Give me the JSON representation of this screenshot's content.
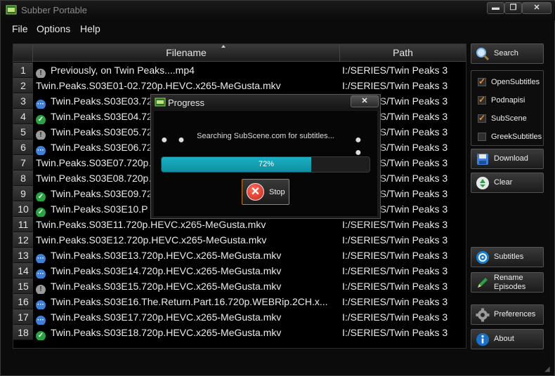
{
  "window": {
    "title": "Subber Portable",
    "min_label": "▬",
    "max_label": "❐",
    "close_label": "✕"
  },
  "menu": [
    "File",
    "Options",
    "Help"
  ],
  "table": {
    "columns": {
      "filename": "Filename",
      "path": "Path"
    },
    "rows": [
      {
        "num": "1",
        "status": "warn",
        "file": "Previously, on Twin Peaks....mp4",
        "path": "I:/SERIES/Twin Peaks 3"
      },
      {
        "num": "2",
        "status": "none",
        "file": "Twin.Peaks.S03E01-02.720p.HEVC.x265-MeGusta.mkv",
        "path": "I:/SERIES/Twin Peaks 3"
      },
      {
        "num": "3",
        "status": "wait",
        "file": "Twin.Peaks.S03E03.720p.HEVC.x265-MeGusta.mkv",
        "path": "I:/SERIES/Twin Peaks 3"
      },
      {
        "num": "4",
        "status": "ok",
        "file": "Twin.Peaks.S03E04.720p.HEVC.x265-MeGusta.mkv",
        "path": "I:/SERIES/Twin Peaks 3"
      },
      {
        "num": "5",
        "status": "warn",
        "file": "Twin.Peaks.S03E05.720p.HEVC.x265-MeGusta.mkv",
        "path": "I:/SERIES/Twin Peaks 3"
      },
      {
        "num": "6",
        "status": "wait",
        "file": "Twin.Peaks.S03E06.720p.HEVC.x265-MeGusta.mkv",
        "path": "I:/SERIES/Twin Peaks 3"
      },
      {
        "num": "7",
        "status": "none",
        "file": "Twin.Peaks.S03E07.720p.HEVC.x265-MeGusta.mkv",
        "path": "I:/SERIES/Twin Peaks 3"
      },
      {
        "num": "8",
        "status": "none",
        "file": "Twin.Peaks.S03E08.720p.HEVC.x265-MeGusta.mkv",
        "path": "I:/SERIES/Twin Peaks 3"
      },
      {
        "num": "9",
        "status": "ok",
        "file": "Twin.Peaks.S03E09.720p.HEVC.x265-MeGusta.mkv",
        "path": "I:/SERIES/Twin Peaks 3"
      },
      {
        "num": "10",
        "status": "ok",
        "file": "Twin.Peaks.S03E10.P",
        "path": "I:/SERIES/Twin Peaks 3"
      },
      {
        "num": "11",
        "status": "none",
        "file": "Twin.Peaks.S03E11.720p.HEVC.x265-MeGusta.mkv",
        "path": "I:/SERIES/Twin Peaks 3"
      },
      {
        "num": "12",
        "status": "none",
        "file": "Twin.Peaks.S03E12.720p.HEVC.x265-MeGusta.mkv",
        "path": "I:/SERIES/Twin Peaks 3"
      },
      {
        "num": "13",
        "status": "wait",
        "file": "Twin.Peaks.S03E13.720p.HEVC.x265-MeGusta.mkv",
        "path": "I:/SERIES/Twin Peaks 3"
      },
      {
        "num": "14",
        "status": "wait",
        "file": "Twin.Peaks.S03E14.720p.HEVC.x265-MeGusta.mkv",
        "path": "I:/SERIES/Twin Peaks 3"
      },
      {
        "num": "15",
        "status": "warn",
        "file": "Twin.Peaks.S03E15.720p.HEVC.x265-MeGusta.mkv",
        "path": "I:/SERIES/Twin Peaks 3"
      },
      {
        "num": "16",
        "status": "wait",
        "file": "Twin.Peaks.S03E16.The.Return.Part.16.720p.WEBRip.2CH.x...",
        "path": "I:/SERIES/Twin Peaks 3"
      },
      {
        "num": "17",
        "status": "wait",
        "file": "Twin.Peaks.S03E17.720p.HEVC.x265-MeGusta.mkv",
        "path": "I:/SERIES/Twin Peaks 3"
      },
      {
        "num": "18",
        "status": "ok",
        "file": "Twin.Peaks.S03E18.720p.HEVC.x265-MeGusta.mkv",
        "path": "I:/SERIES/Twin Peaks 3"
      }
    ]
  },
  "sidebar": {
    "search": "Search",
    "providers": [
      {
        "label": "OpenSubtitles",
        "checked": true
      },
      {
        "label": "Podnapisi",
        "checked": true
      },
      {
        "label": "SubScene",
        "checked": true
      },
      {
        "label": "GreekSubtitles",
        "checked": false
      }
    ],
    "download": "Download",
    "clear": "Clear",
    "subtitles": "Subtitles",
    "rename_line1": "Rename",
    "rename_line2": "Episodes",
    "preferences": "Preferences",
    "about": "About"
  },
  "dialog": {
    "title": "Progress",
    "close_label": "✕",
    "left_dots": "● ●",
    "right_dots": "● ●",
    "status": "Searching SubScene.com for subtitles...",
    "progress_value": 72,
    "progress_text": "72%",
    "stop": "Stop"
  },
  "colors": {
    "accent_progress": "#1ab0c4",
    "ok": "#2aa142",
    "wait": "#3f7fd6",
    "warn": "#9a9a9a",
    "stop_border": "#c77a1a"
  }
}
